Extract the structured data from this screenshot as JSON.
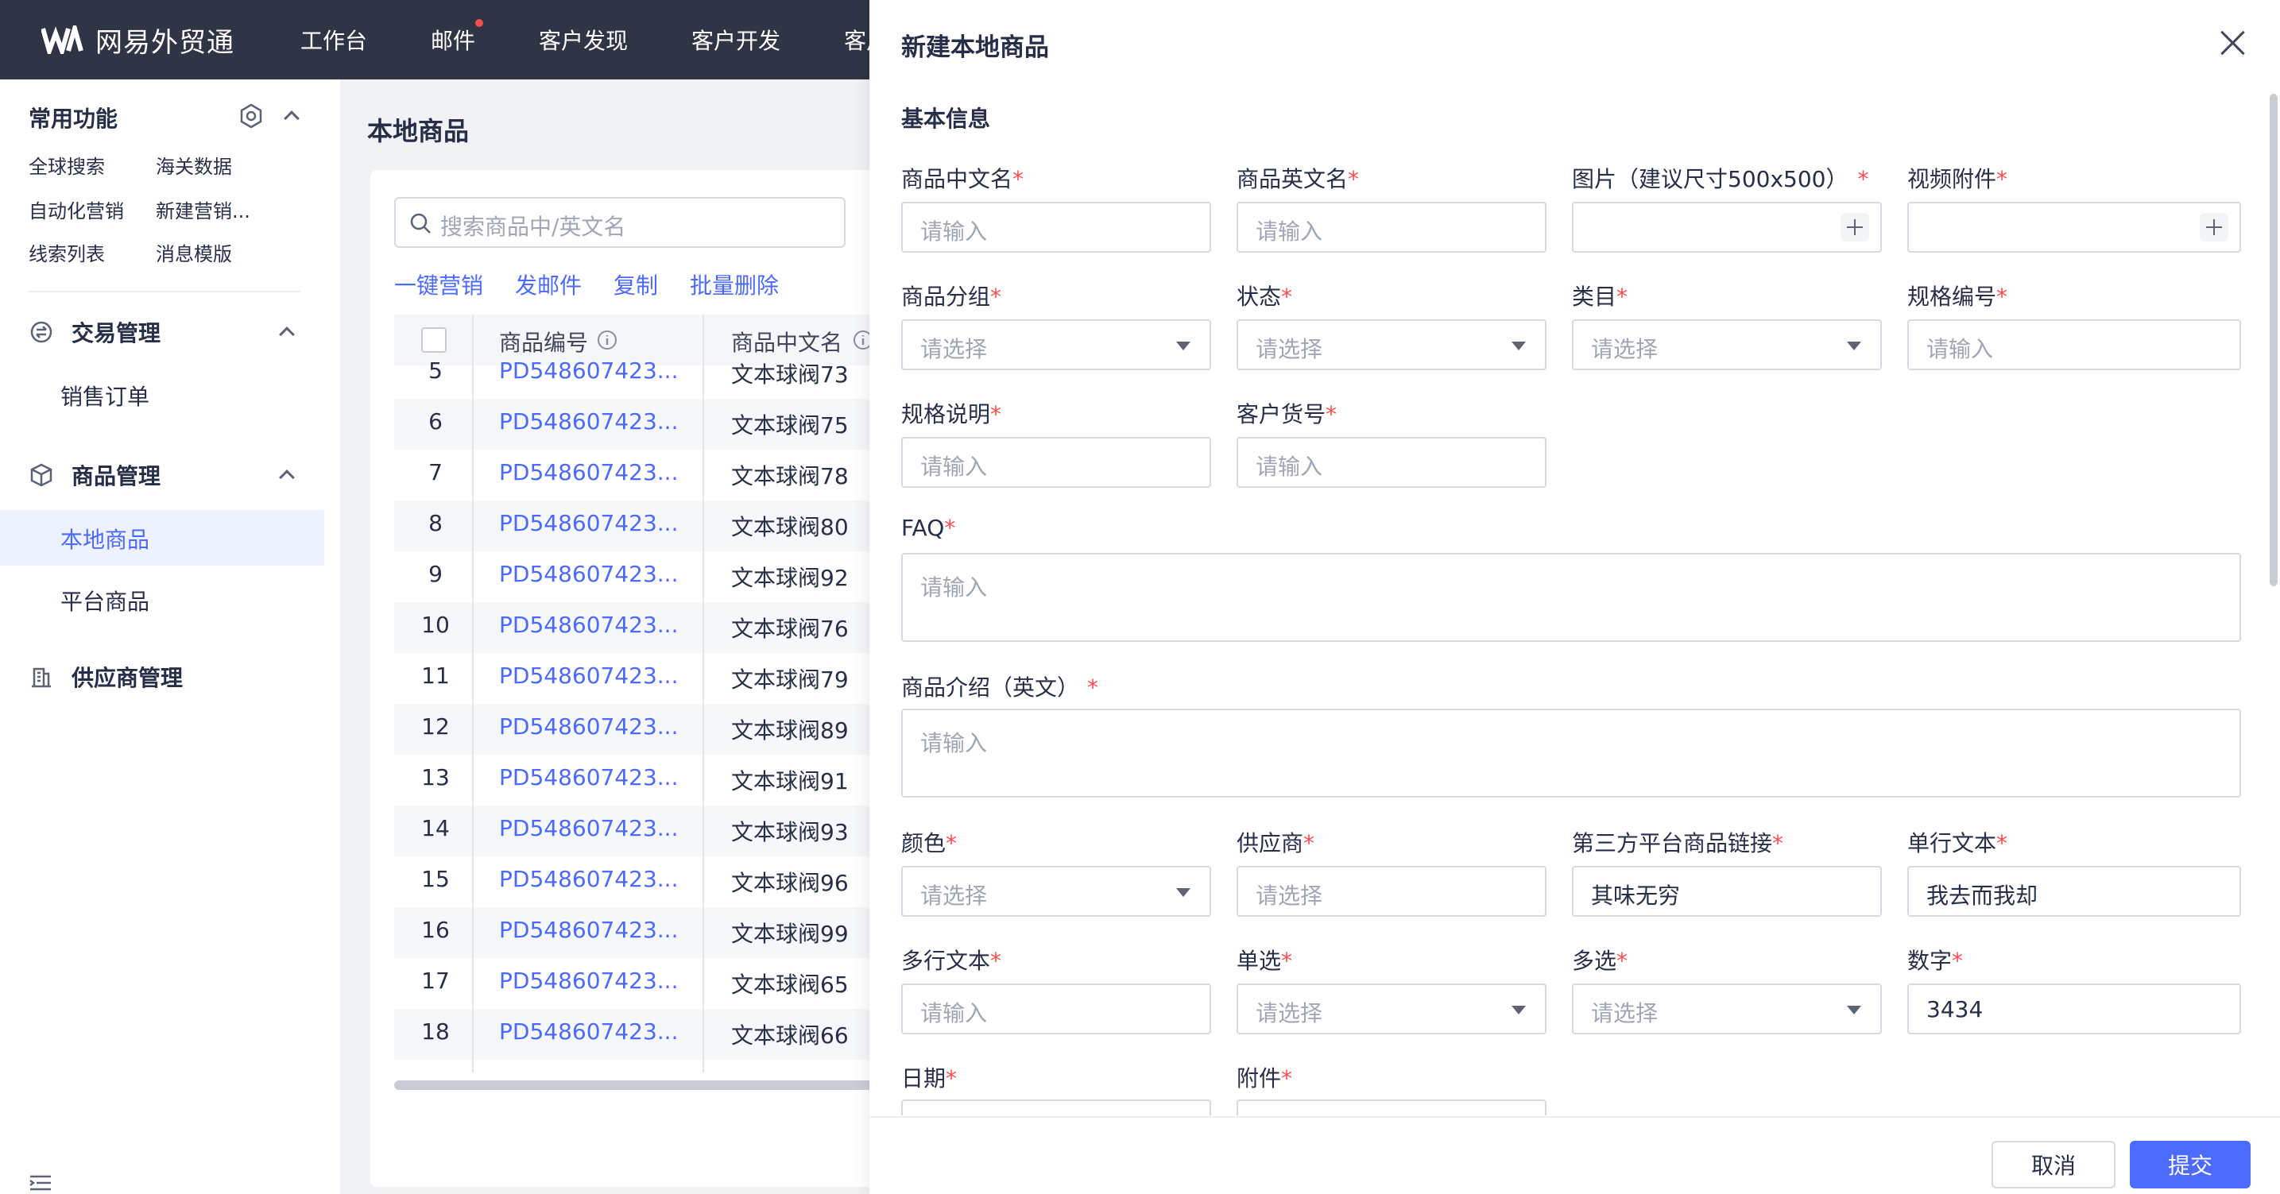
{
  "app": {
    "title": "网易外贸通"
  },
  "topnav": {
    "items": [
      "工作台",
      "邮件",
      "客户发现",
      "客户开发",
      "客户"
    ]
  },
  "sidebar": {
    "common_title": "常用功能",
    "quick_links": [
      "全球搜索",
      "海关数据",
      "自动化营销",
      "新建营销...",
      "线索列表",
      "消息模版"
    ],
    "groups": [
      {
        "label": "交易管理",
        "icon": "transaction-icon",
        "items": [
          "销售订单"
        ]
      },
      {
        "label": "商品管理",
        "icon": "box-icon",
        "items": [
          "本地商品",
          "平台商品"
        ]
      },
      {
        "label": "供应商管理",
        "icon": "building-icon",
        "items": []
      }
    ],
    "active_item": "本地商品"
  },
  "main": {
    "title": "本地商品",
    "search_placeholder": "搜索商品中/英文名",
    "actions": [
      "一键营销",
      "发邮件",
      "复制",
      "批量删除"
    ],
    "columns": [
      "商品编号",
      "商品中文名"
    ],
    "rows": [
      {
        "idx": "5",
        "code": "PD548607423...",
        "name": "文本球阀73"
      },
      {
        "idx": "6",
        "code": "PD548607423...",
        "name": "文本球阀75"
      },
      {
        "idx": "7",
        "code": "PD548607423...",
        "name": "文本球阀78"
      },
      {
        "idx": "8",
        "code": "PD548607423...",
        "name": "文本球阀80"
      },
      {
        "idx": "9",
        "code": "PD548607423...",
        "name": "文本球阀92"
      },
      {
        "idx": "10",
        "code": "PD548607423...",
        "name": "文本球阀76"
      },
      {
        "idx": "11",
        "code": "PD548607423...",
        "name": "文本球阀79"
      },
      {
        "idx": "12",
        "code": "PD548607423...",
        "name": "文本球阀89"
      },
      {
        "idx": "13",
        "code": "PD548607423...",
        "name": "文本球阀91"
      },
      {
        "idx": "14",
        "code": "PD548607423...",
        "name": "文本球阀93"
      },
      {
        "idx": "15",
        "code": "PD548607423...",
        "name": "文本球阀96"
      },
      {
        "idx": "16",
        "code": "PD548607423...",
        "name": "文本球阀99"
      },
      {
        "idx": "17",
        "code": "PD548607423...",
        "name": "文本球阀65"
      },
      {
        "idx": "18",
        "code": "PD548607423...",
        "name": "文本球阀66"
      }
    ]
  },
  "drawer": {
    "title": "新建本地商品",
    "section": "基本信息",
    "fields": {
      "name_cn": {
        "label": "商品中文名",
        "placeholder": "请输入"
      },
      "name_en": {
        "label": "商品英文名",
        "placeholder": "请输入"
      },
      "image": {
        "label": "图片（建议尺寸500x500）"
      },
      "video": {
        "label": "视频附件"
      },
      "group": {
        "label": "商品分组",
        "placeholder": "请选择"
      },
      "status": {
        "label": "状态",
        "placeholder": "请选择"
      },
      "category": {
        "label": "类目",
        "placeholder": "请选择"
      },
      "spec_no": {
        "label": "规格编号",
        "placeholder": "请输入"
      },
      "spec_desc": {
        "label": "规格说明",
        "placeholder": "请输入"
      },
      "customer_no": {
        "label": "客户货号",
        "placeholder": "请输入"
      },
      "faq": {
        "label": "FAQ",
        "placeholder": "请输入"
      },
      "intro_en": {
        "label": "商品介绍（英文）",
        "placeholder": "请输入"
      },
      "color": {
        "label": "颜色",
        "placeholder": "请选择"
      },
      "supplier": {
        "label": "供应商",
        "placeholder": "请选择"
      },
      "third_link": {
        "label": "第三方平台商品链接",
        "value": "其味无穷"
      },
      "single_text": {
        "label": "单行文本",
        "value": "我去而我却"
      },
      "multi_text": {
        "label": "多行文本",
        "placeholder": "请输入"
      },
      "single_select": {
        "label": "单选",
        "placeholder": "请选择"
      },
      "multi_select": {
        "label": "多选",
        "placeholder": "请选择"
      },
      "number": {
        "label": "数字",
        "value": "3434"
      },
      "date": {
        "label": "日期"
      },
      "attachment": {
        "label": "附件"
      }
    },
    "required_mark": "*",
    "buttons": {
      "cancel": "取消",
      "submit": "提交"
    }
  }
}
